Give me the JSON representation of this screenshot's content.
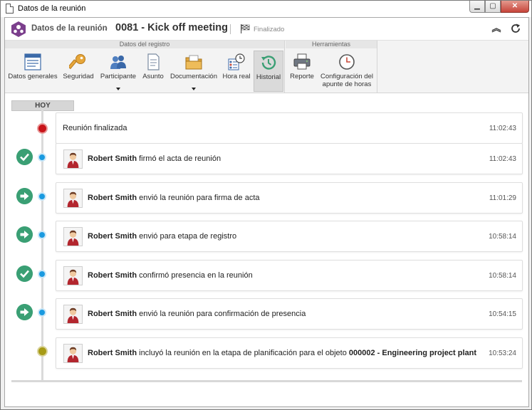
{
  "window": {
    "title": "Datos de la reunión",
    "minimize": "▁",
    "maximize": "▢",
    "close": "✕"
  },
  "header": {
    "breadcrumb": "Datos de la reunión",
    "separator": "›",
    "record_title": "0081 - Kick off meeting",
    "status": "Finalizado",
    "collapse_glyph": "︽"
  },
  "ribbon": {
    "groups": [
      {
        "label": "Datos del registro"
      },
      {
        "label": "Herramientas"
      }
    ],
    "buttons": [
      {
        "label": "Datos generales",
        "icon": "form-icon"
      },
      {
        "label": "Seguridad",
        "icon": "key-icon"
      },
      {
        "label": "Participante",
        "icon": "people-icon",
        "dropdown": true
      },
      {
        "label": "Asunto",
        "icon": "document-icon"
      },
      {
        "label": "Documentación",
        "icon": "folder-icon",
        "dropdown": true
      },
      {
        "label": "Hora real",
        "icon": "clock-grid-icon"
      },
      {
        "label": "Historial",
        "icon": "history-icon",
        "active": true
      },
      {
        "label": "Reporte",
        "icon": "printer-icon"
      },
      {
        "label": "Configuración del apunte de horas",
        "icon": "clock-icon"
      }
    ]
  },
  "timeline": {
    "day_label": "HOY",
    "entries": [
      {
        "user": "",
        "text": "Reunión finalizada",
        "time": "11:02:43",
        "node": "red",
        "action": ""
      },
      {
        "user": "Robert Smith",
        "text": " firmó el acta de reunión",
        "time": "11:02:43",
        "node": "blue",
        "action": "check"
      },
      {
        "user": "Robert Smith",
        "text": " envió la reunión para firma de acta",
        "time": "11:01:29",
        "node": "blue",
        "action": "arrow"
      },
      {
        "user": "Robert Smith",
        "text": " envió para etapa de registro",
        "time": "10:58:14",
        "node": "blue",
        "action": "arrow"
      },
      {
        "user": "Robert Smith",
        "text": " confirmó presencia en la reunión",
        "time": "10:58:14",
        "node": "blue",
        "action": "check"
      },
      {
        "user": "Robert Smith",
        "text": " envió la reunión para confirmación de presencia",
        "time": "10:54:15",
        "node": "blue",
        "action": "arrow"
      },
      {
        "user": "Robert Smith",
        "text": " incluyó la reunión en la etapa de planificación para el objeto ",
        "object": "000002 - Engineering project plant",
        "time": "10:53:24",
        "node": "olive",
        "action": ""
      }
    ]
  },
  "colors": {
    "accent_purple": "#7b3f8c",
    "node_blue": "#1a9ae0",
    "node_red": "#c8141a",
    "node_olive": "#a79b16",
    "action_green": "#3a9f74"
  }
}
